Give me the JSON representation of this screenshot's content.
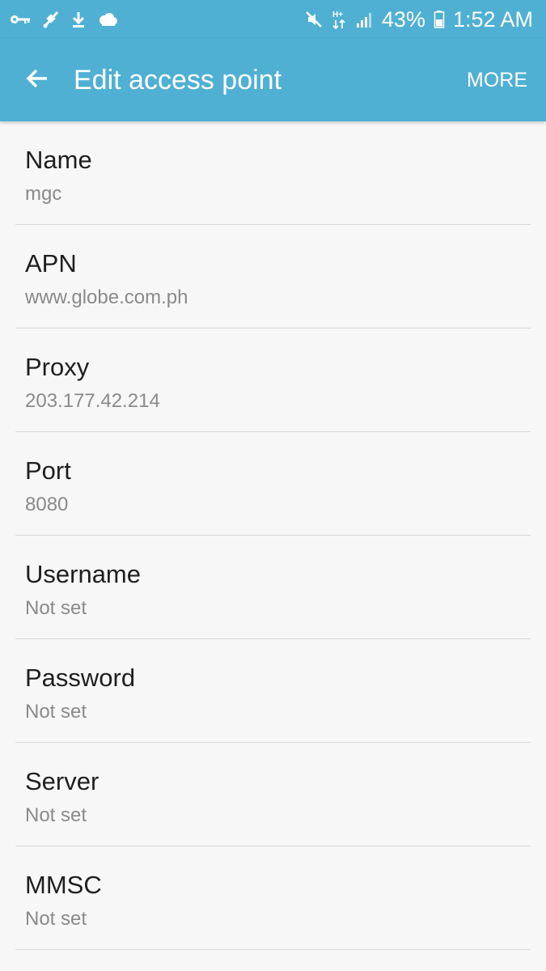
{
  "status_bar": {
    "battery_percent": "43%",
    "time": "1:52 AM",
    "signal_label": "H+",
    "left_icons": [
      "key-icon",
      "satellite-icon",
      "download-icon",
      "cloud-icon"
    ],
    "right_icons": [
      "mute-icon",
      "h-plus-data-icon",
      "signal-icon",
      "battery-icon"
    ]
  },
  "app_bar": {
    "title": "Edit access point",
    "more_label": "MORE",
    "color": "#4fb0d3"
  },
  "items": [
    {
      "label": "Name",
      "value": "mgc"
    },
    {
      "label": "APN",
      "value": "www.globe.com.ph"
    },
    {
      "label": "Proxy",
      "value": "203.177.42.214"
    },
    {
      "label": "Port",
      "value": "8080"
    },
    {
      "label": "Username",
      "value": "Not set"
    },
    {
      "label": "Password",
      "value": "Not set"
    },
    {
      "label": "Server",
      "value": "Not set"
    },
    {
      "label": "MMSC",
      "value": "Not set"
    }
  ]
}
